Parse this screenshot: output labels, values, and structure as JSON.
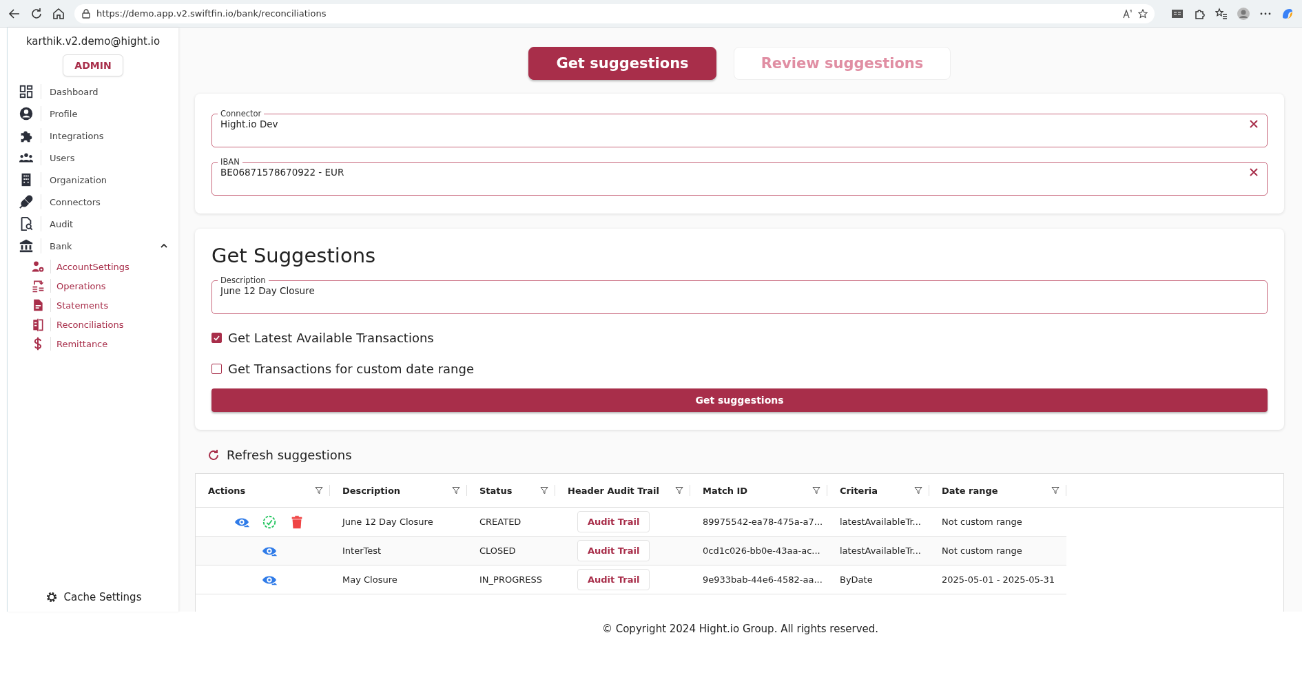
{
  "browser": {
    "url": "https://demo.app.v2.swiftfin.io/bank/reconciliations"
  },
  "sidebar": {
    "email": "karthik.v2.demo@hight.io",
    "role": "ADMIN",
    "items": [
      {
        "label": "Dashboard"
      },
      {
        "label": "Profile"
      },
      {
        "label": "Integrations"
      },
      {
        "label": "Users"
      },
      {
        "label": "Organization"
      },
      {
        "label": "Connectors"
      },
      {
        "label": "Audit"
      },
      {
        "label": "Bank",
        "expanded": true,
        "children": [
          {
            "label": "AccountSettings"
          },
          {
            "label": "Operations"
          },
          {
            "label": "Statements"
          },
          {
            "label": "Reconciliations"
          },
          {
            "label": "Remittance"
          }
        ]
      }
    ],
    "footer_item": {
      "label": "Cache Settings"
    }
  },
  "tabs": [
    {
      "label": "Get suggestions",
      "selected": true
    },
    {
      "label": "Review suggestions",
      "selected": false
    }
  ],
  "source_fields": [
    {
      "label": "Connector",
      "value": "Hight.io Dev"
    },
    {
      "label": "IBAN",
      "value": "BE06871578670922 - EUR"
    }
  ],
  "form": {
    "title": "Get Suggestions",
    "description": {
      "label": "Description",
      "value": "June 12 Day Closure"
    },
    "options": [
      {
        "label": "Get Latest Available Transactions",
        "checked": true
      },
      {
        "label": "Get Transactions for custom date range",
        "checked": false
      }
    ],
    "submit": "Get suggestions"
  },
  "refresh": "Refresh suggestions",
  "table": {
    "columns": [
      "Actions",
      "Description",
      "Status",
      "Header Audit Trail",
      "Match ID",
      "Criteria",
      "Date range"
    ],
    "rows": [
      {
        "actions": [
          {
            "kind": "view"
          },
          {
            "kind": "approve"
          },
          {
            "kind": "delete"
          }
        ],
        "description": "June 12 Day Closure",
        "status": "CREATED",
        "audit": "Audit Trail",
        "match_id": "89975542-ea78-475a-a7...",
        "criteria": "latestAvailableTr...",
        "date_range": "Not custom range"
      },
      {
        "actions": [
          {
            "kind": "view"
          }
        ],
        "description": "InterTest",
        "status": "CLOSED",
        "audit": "Audit Trail",
        "match_id": "0cd1c026-bb0e-43aa-ac...",
        "criteria": "latestAvailableTr...",
        "date_range": "Not custom range"
      },
      {
        "actions": [
          {
            "kind": "view"
          }
        ],
        "description": "May Closure",
        "status": "IN_PROGRESS",
        "audit": "Audit Trail",
        "match_id": "9e933bab-44e6-4582-aa...",
        "criteria": "ByDate",
        "date_range": "2025-05-01 - 2025-05-31"
      }
    ]
  },
  "footer": "© Copyright 2024 Hight.io Group. All rights reserved."
}
